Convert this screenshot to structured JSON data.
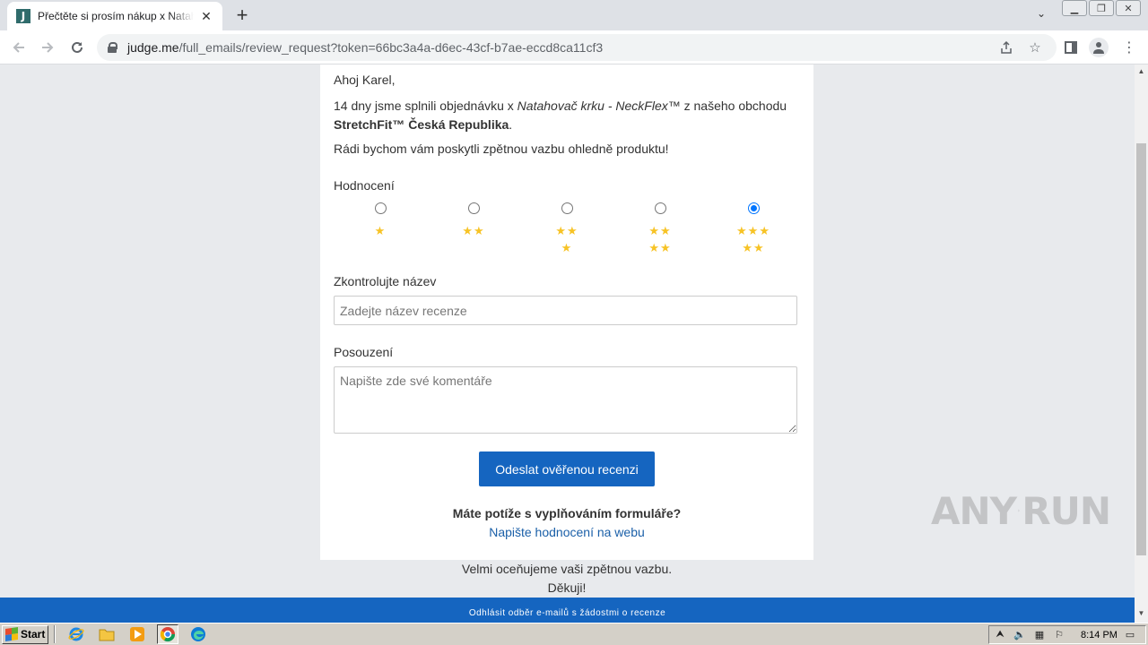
{
  "browser": {
    "tab_title": "Přečtěte si prosím nákup x Natahovač krku",
    "tab_favicon_letter": "J",
    "url_host": "judge.me",
    "url_path": "/full_emails/review_request?token=66bc3a4a-d6ec-43cf-b7ae-eccd8ca11cf3"
  },
  "email": {
    "greeting": "Ahoj Karel,",
    "para1_prefix": "14 dny jsme splnili objednávku x ",
    "product_name": "Natahovač krku - NeckFlex™",
    "para1_middle": " z našeho obchodu ",
    "shop_name": "StretchFit™ Česká Republika",
    "para1_suffix": ".",
    "para2": "Rádi bychom vám poskytli zpětnou vazbu ohledně produktu!",
    "rating_label": "Hodnocení",
    "rating_options": [
      {
        "stars_line1": "★",
        "stars_line2": "",
        "value": 1,
        "selected": false
      },
      {
        "stars_line1": "★★",
        "stars_line2": "",
        "value": 2,
        "selected": false
      },
      {
        "stars_line1": "★★",
        "stars_line2": "★",
        "value": 3,
        "selected": false
      },
      {
        "stars_line1": "★★",
        "stars_line2": "★★",
        "value": 4,
        "selected": false
      },
      {
        "stars_line1": "★★★",
        "stars_line2": "★★",
        "value": 5,
        "selected": true
      }
    ],
    "title_label": "Zkontrolujte název",
    "title_placeholder": "Zadejte název recenze",
    "review_label": "Posouzení",
    "review_placeholder": "Napište zde své komentáře",
    "submit_label": "Odeslat ověřenou recenzi",
    "trouble_text": "Máte potíže s vyplňováním formuláře?",
    "web_link": "Napište hodnocení na webu",
    "appreciate_text": "Velmi oceňujeme vaši zpětnou vazbu.",
    "thanks_text": "Děkuji!",
    "unsubscribe_text": "Odhlásit odběr e-mailů s žádostmi o recenze"
  },
  "watermark": {
    "text_left": "ANY",
    "text_right": "RUN"
  },
  "taskbar": {
    "start_label": "Start",
    "clock": "8:14 PM"
  },
  "colors": {
    "accent": "#1565c0",
    "star": "#f7c325",
    "page_bg": "#e8eaed"
  }
}
